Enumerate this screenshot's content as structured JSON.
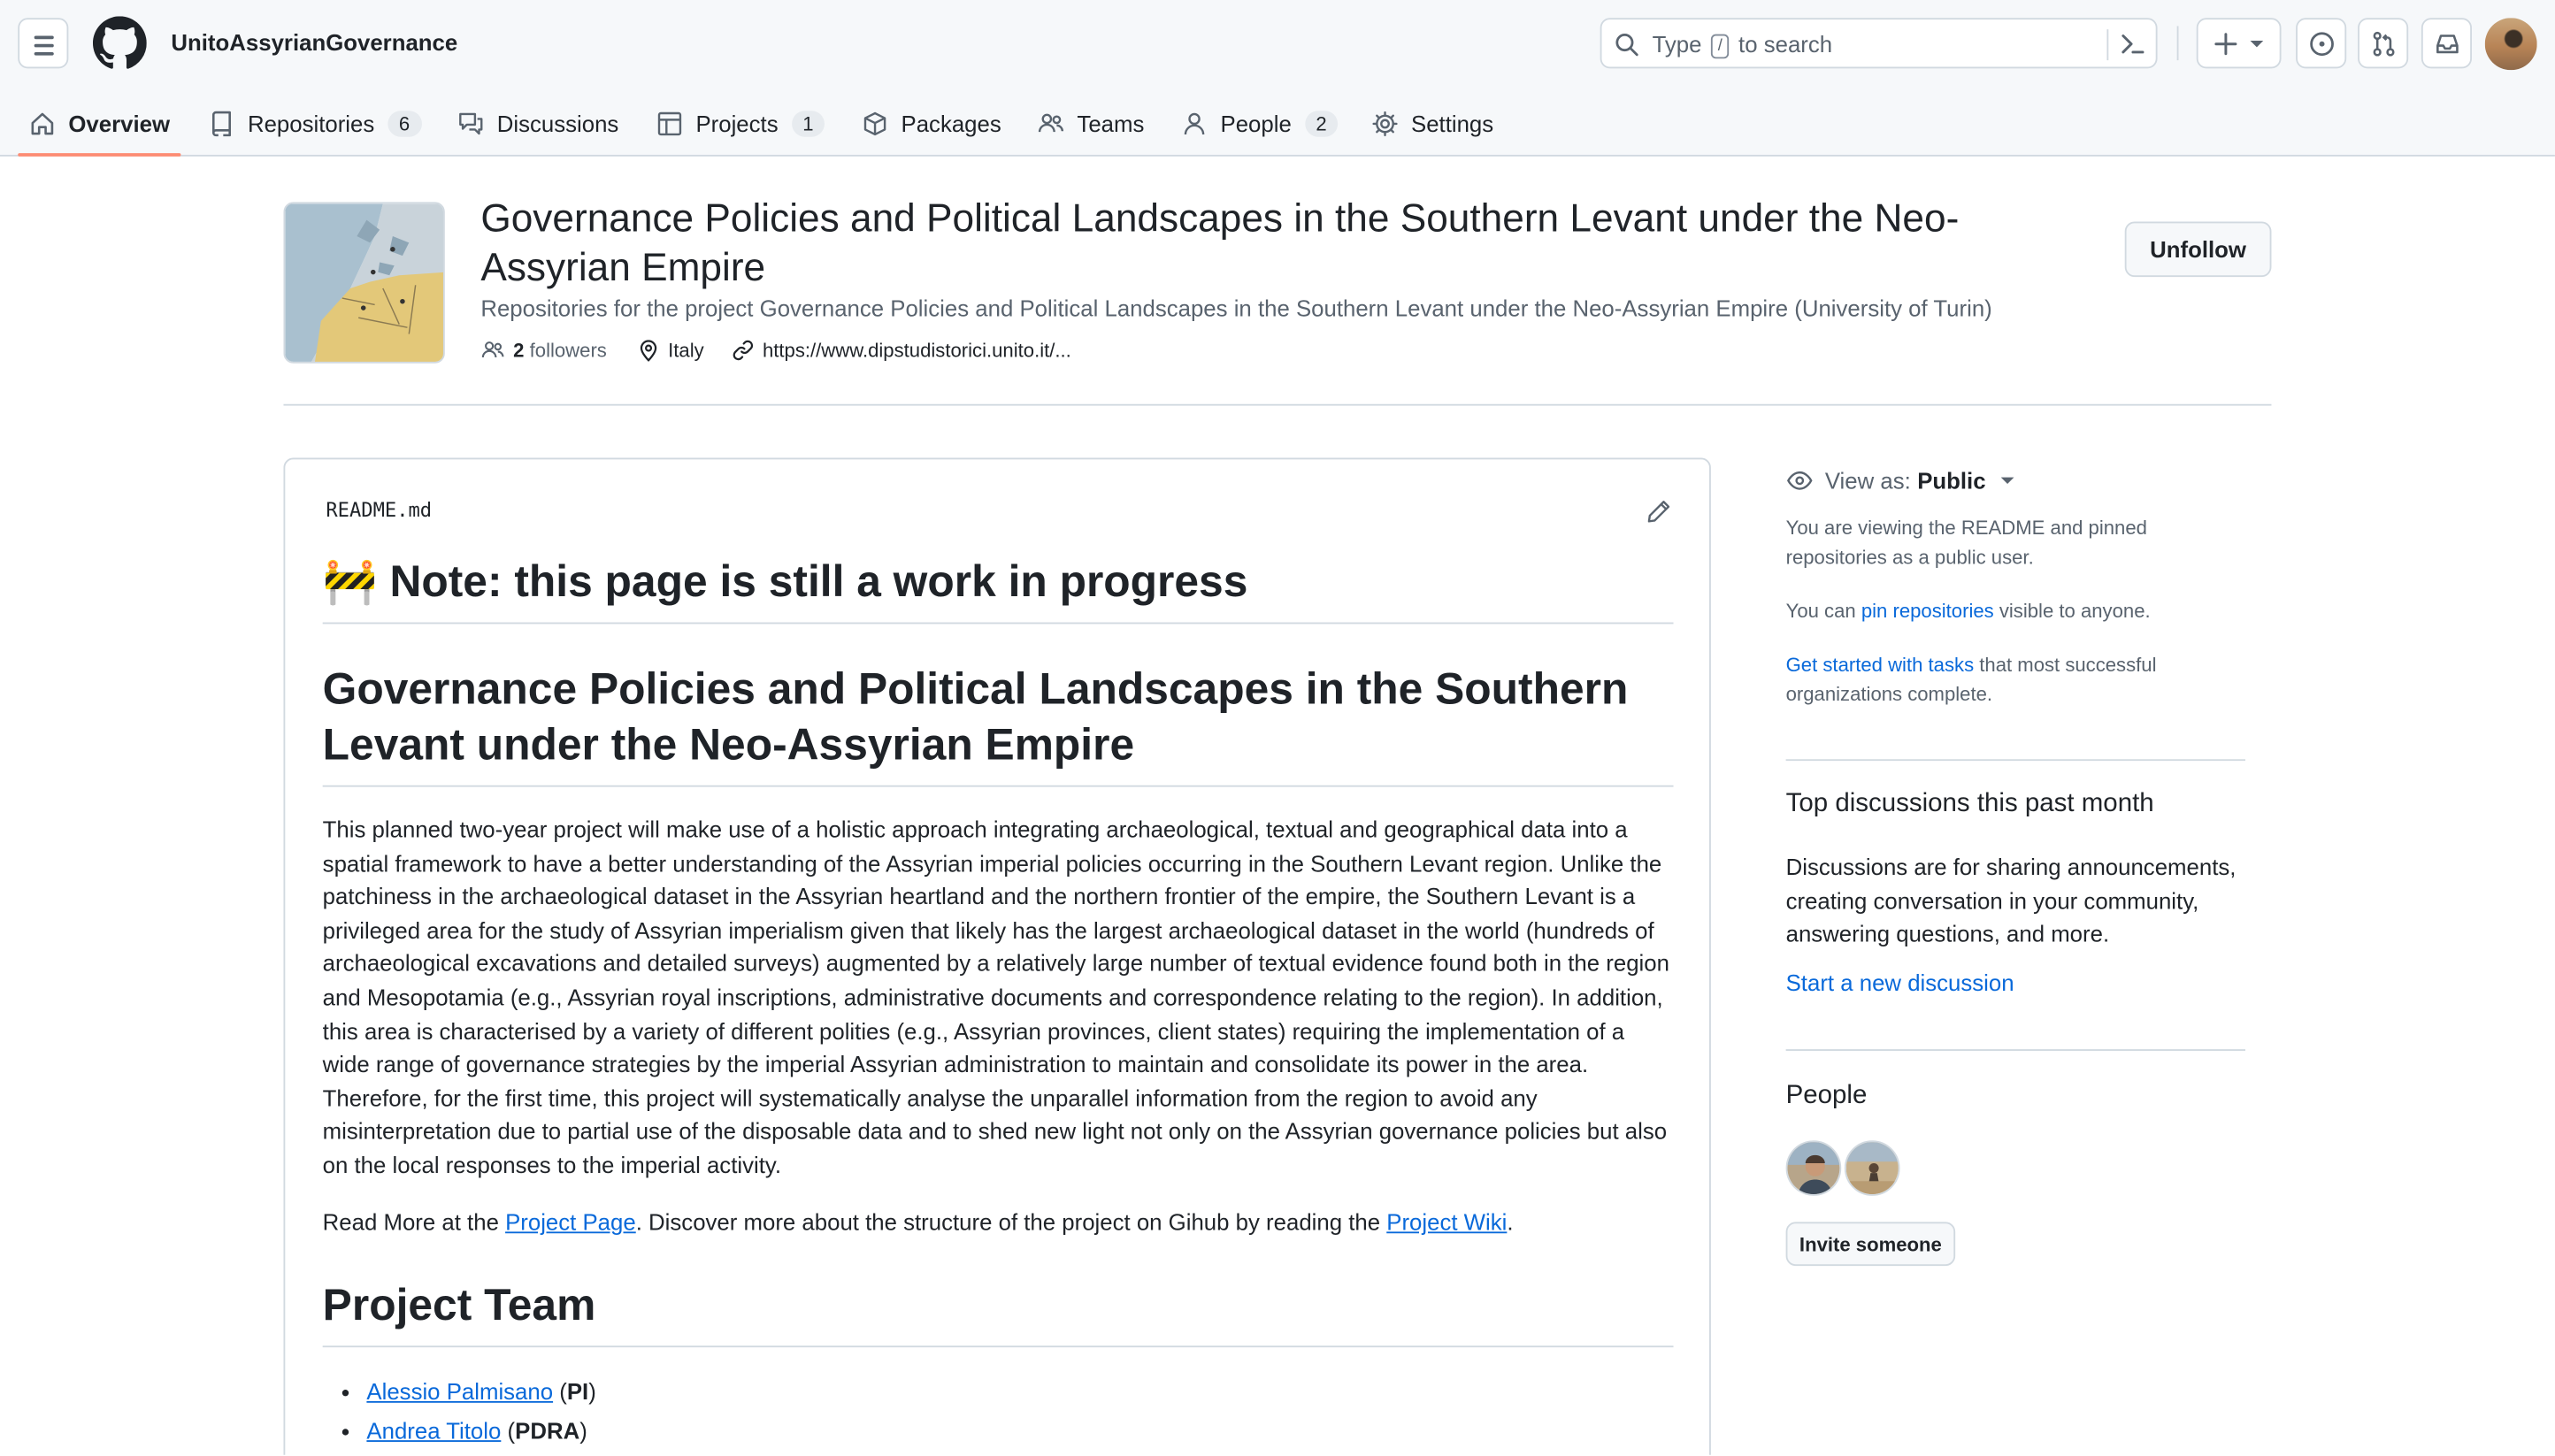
{
  "header": {
    "org_name": "UnitoAssyrianGovernance",
    "search_prefix": "Type",
    "search_key": "/",
    "search_suffix": "to search"
  },
  "tabs": [
    {
      "label": "Overview",
      "icon": "home-icon",
      "selected": true
    },
    {
      "label": "Repositories",
      "icon": "repo-icon",
      "count": "6"
    },
    {
      "label": "Discussions",
      "icon": "comment-discussion-icon"
    },
    {
      "label": "Projects",
      "icon": "table-icon",
      "count": "1"
    },
    {
      "label": "Packages",
      "icon": "package-icon"
    },
    {
      "label": "Teams",
      "icon": "people-icon"
    },
    {
      "label": "People",
      "icon": "person-icon",
      "count": "2"
    },
    {
      "label": "Settings",
      "icon": "gear-icon"
    }
  ],
  "org": {
    "title": "Governance Policies and Political Landscapes in the Southern Levant under the Neo-Assyrian Empire",
    "description": "Repositories for the project Governance Policies and Political Landscapes in the Southern Levant under the Neo-Assyrian Empire (University of Turin)",
    "followers_count": "2",
    "followers_label": "followers",
    "location": "Italy",
    "website": "https://www.dipstudistorici.unito.it/...",
    "unfollow_label": "Unfollow"
  },
  "readme": {
    "filename": "README.md",
    "wip_emoji": "🚧",
    "wip_heading": "Note: this page is still a work in progress",
    "title": "Governance Policies and Political Landscapes in the Southern Levant under the Neo-Assyrian Empire",
    "paragraph": "This planned two-year project will make use of a holistic approach integrating archaeological, textual and geographical data into a spatial framework to have a better understanding of the Assyrian imperial policies occurring in the Southern Levant region. Unlike the patchiness in the archaeological dataset in the Assyrian heartland and the northern frontier of the empire, the Southern Levant is a privileged area for the study of Assyrian imperialism given that likely has the largest archaeological dataset in the world (hundreds of archaeological excavations and detailed surveys) augmented by a relatively large number of textual evidence found both in the region and Mesopotamia (e.g., Assyrian royal inscriptions, administrative documents and correspondence relating to the region). In addition, this area is characterised by a variety of different polities (e.g., Assyrian provinces, client states) requiring the implementation of a wide range of governance strategies by the imperial Assyrian administration to maintain and consolidate its power in the area. Therefore, for the first time, this project will systematically analyse the unparallel information from the region to avoid any misinterpretation due to partial use of the disposable data and to shed new light not only on the Assyrian governance policies but also on the local responses to the imperial activity.",
    "read_more_1": "Read More at the ",
    "project_page_link": "Project Page",
    "read_more_2": ". Discover more about the structure of the project on Gihub by reading the ",
    "project_wiki_link": "Project Wiki",
    "read_more_3": ".",
    "team_heading": "Project Team",
    "team": [
      {
        "name": "Alessio Palmisano",
        "role": "PI"
      },
      {
        "name": "Andrea Titolo",
        "role": "PDRA"
      }
    ]
  },
  "sidebar": {
    "view_as_label": "View as:",
    "view_as_value": "Public",
    "note1": "You are viewing the README and pinned repositories as a public user.",
    "note2_prefix": "You can ",
    "note2_link": "pin repositories",
    "note2_suffix": " visible to anyone.",
    "note3_link": "Get started with tasks",
    "note3_suffix": " that most successful organizations complete.",
    "discussions_heading": "Top discussions this past month",
    "discussions_text": "Discussions are for sharing announcements, creating conversation in your community, answering questions, and more.",
    "start_discussion": "Start a new discussion",
    "people_heading": "People",
    "invite_label": "Invite someone"
  },
  "colors": {
    "accent_link": "#0969da",
    "tab_underline": "#fd8c73",
    "border": "#d1d9e0",
    "muted": "#59636e"
  }
}
